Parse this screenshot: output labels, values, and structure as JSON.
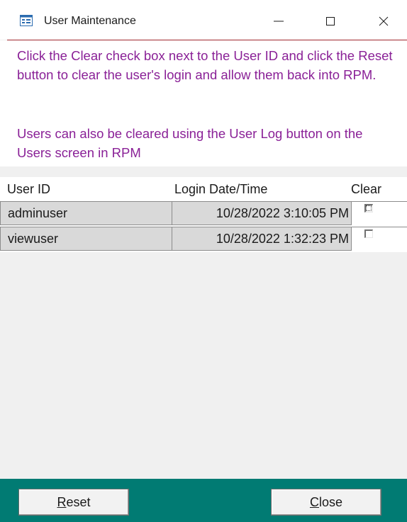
{
  "window": {
    "title": "User Maintenance",
    "icon": "form-icon",
    "controls": {
      "minimize": "minimize-icon",
      "maximize": "maximize-icon",
      "close": "close-icon"
    }
  },
  "message": {
    "line1": "Click the Clear check box next to the User ID and click the Reset button to clear the user's login and allow them  back into RPM.",
    "line2": "Users can also be cleared using the User Log button on the Users screen in RPM",
    "color": "#8a2197"
  },
  "grid": {
    "columns": {
      "user_id": "User ID",
      "login": "Login Date/Time",
      "clear": "Clear"
    },
    "rows": [
      {
        "user_id": "adminuser",
        "login": "10/28/2022 3:10:05 PM",
        "clear": false
      },
      {
        "user_id": "viewuser",
        "login": "10/28/2022 1:32:23 PM",
        "clear": false
      }
    ]
  },
  "footer": {
    "color": "#017b73",
    "reset": {
      "accel": "R",
      "rest": "eset"
    },
    "close": {
      "accel": "C",
      "rest": "lose"
    }
  }
}
